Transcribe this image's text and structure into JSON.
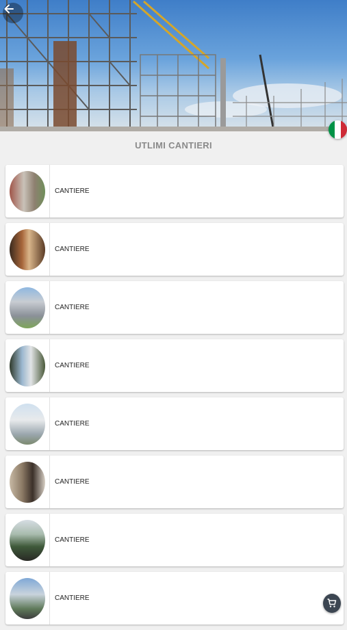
{
  "hero": {
    "image": "construction-scaffolding-photo"
  },
  "header": {
    "back_icon": "arrow-left-icon",
    "language_flag": "italy-flag-icon"
  },
  "flag_colors": [
    "#009246",
    "#ffffff",
    "#ce2b37"
  ],
  "section": {
    "title": "UTLIMI CANTIERI"
  },
  "list": {
    "items": [
      {
        "label": "CANTIERE",
        "thumb": "building-photo-1"
      },
      {
        "label": "CANTIERE",
        "thumb": "building-photo-2"
      },
      {
        "label": "CANTIERE",
        "thumb": "building-photo-3"
      },
      {
        "label": "CANTIERE",
        "thumb": "building-photo-4"
      },
      {
        "label": "CANTIERE",
        "thumb": "building-photo-5"
      },
      {
        "label": "CANTIERE",
        "thumb": "building-photo-6"
      },
      {
        "label": "CANTIERE",
        "thumb": "building-photo-7"
      },
      {
        "label": "CANTIERE",
        "thumb": "building-photo-8"
      }
    ]
  },
  "cart": {
    "icon": "cart-icon",
    "color": "#3c4652"
  }
}
